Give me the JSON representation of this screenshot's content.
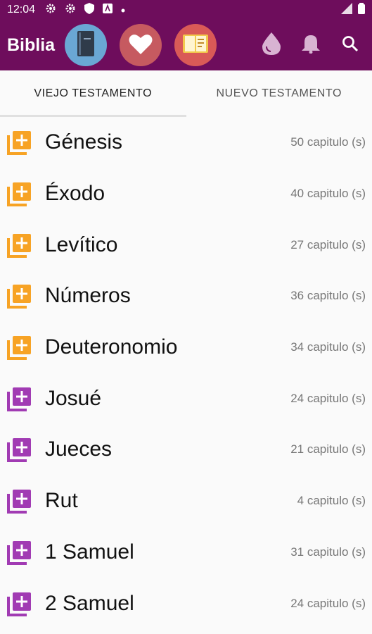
{
  "status_bar": {
    "time": "12:04"
  },
  "app_bar": {
    "title": "Biblia"
  },
  "tabs": [
    {
      "label": "VIEJO TESTAMENTO",
      "active": true
    },
    {
      "label": "NUEVO TESTAMENTO",
      "active": false
    }
  ],
  "colors": {
    "primary": "#6e0d5c",
    "orange_icon": "#f7a325",
    "purple_icon": "#a13bb3"
  },
  "books": [
    {
      "name": "Génesis",
      "chapters": "50 capitulo (s)",
      "icon_color": "orange"
    },
    {
      "name": "Éxodo",
      "chapters": "40 capitulo (s)",
      "icon_color": "orange"
    },
    {
      "name": "Levítico",
      "chapters": "27 capitulo (s)",
      "icon_color": "orange"
    },
    {
      "name": "Números",
      "chapters": "36 capitulo (s)",
      "icon_color": "orange"
    },
    {
      "name": "Deuteronomio",
      "chapters": "34 capitulo (s)",
      "icon_color": "orange"
    },
    {
      "name": "Josué",
      "chapters": "24 capitulo (s)",
      "icon_color": "purple"
    },
    {
      "name": "Jueces",
      "chapters": "21 capitulo (s)",
      "icon_color": "purple"
    },
    {
      "name": "Rut",
      "chapters": "4 capitulo (s)",
      "icon_color": "purple"
    },
    {
      "name": "1 Samuel",
      "chapters": "31 capitulo (s)",
      "icon_color": "purple"
    },
    {
      "name": "2 Samuel",
      "chapters": "24 capitulo (s)",
      "icon_color": "purple"
    }
  ]
}
